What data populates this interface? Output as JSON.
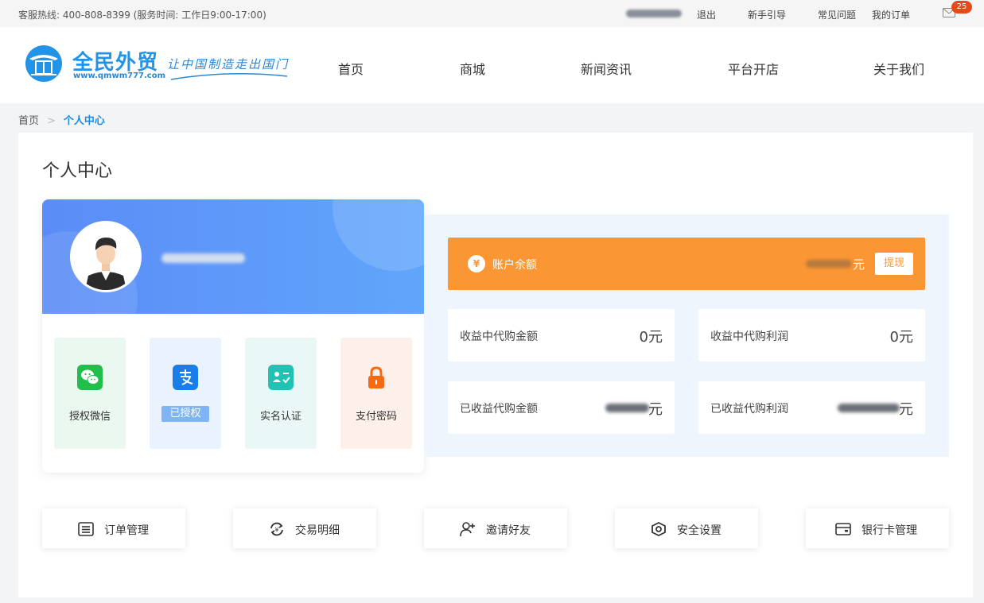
{
  "topbar": {
    "hotline": "客服热线: 400-808-8399 (服务时间: 工作日9:00-17:00)",
    "logout": "退出",
    "guide": "新手引导",
    "faq": "常见问题",
    "orders": "我的订单",
    "mail_badge": "25"
  },
  "header": {
    "brand": "全民外贸",
    "brand_url": "www.qmwm777.com",
    "slogan": "让中国制造走出国门",
    "nav": [
      "首页",
      "商城",
      "新闻资讯",
      "平台开店",
      "关于我们"
    ]
  },
  "breadcrumb": {
    "home": "首页",
    "sep": ">",
    "current": "个人中心"
  },
  "page": {
    "title": "个人中心"
  },
  "profile": {
    "tiles": [
      {
        "label": "授权微信",
        "icon": "wechat-icon",
        "bg": "#eaf8f0"
      },
      {
        "label": "已授权",
        "icon": "alipay-icon",
        "bg": "#eaf3fd"
      },
      {
        "label": "实名认证",
        "icon": "id-card-icon",
        "bg": "#e9f8f6"
      },
      {
        "label": "支付密码",
        "icon": "lock-icon",
        "bg": "#fdf0ea"
      }
    ]
  },
  "balance": {
    "label": "账户余额",
    "unit": "元",
    "withdraw": "提现",
    "stats": [
      {
        "label": "收益中代购金额",
        "value": "0元"
      },
      {
        "label": "收益中代购利润",
        "value": "0元"
      },
      {
        "label": "已收益代购金额",
        "unit": "元"
      },
      {
        "label": "已收益代购利润",
        "unit": "元"
      }
    ]
  },
  "quick_links": [
    {
      "label": "订单管理",
      "icon": "list-icon"
    },
    {
      "label": "交易明细",
      "icon": "exchange-icon"
    },
    {
      "label": "邀请好友",
      "icon": "add-user-icon"
    },
    {
      "label": "安全设置",
      "icon": "shield-icon"
    },
    {
      "label": "银行卡管理",
      "icon": "bank-card-icon"
    }
  ],
  "colors": {
    "accent": "#1a8de0",
    "orange": "#fb9635",
    "profile_gradient": "#5b8cf7"
  }
}
